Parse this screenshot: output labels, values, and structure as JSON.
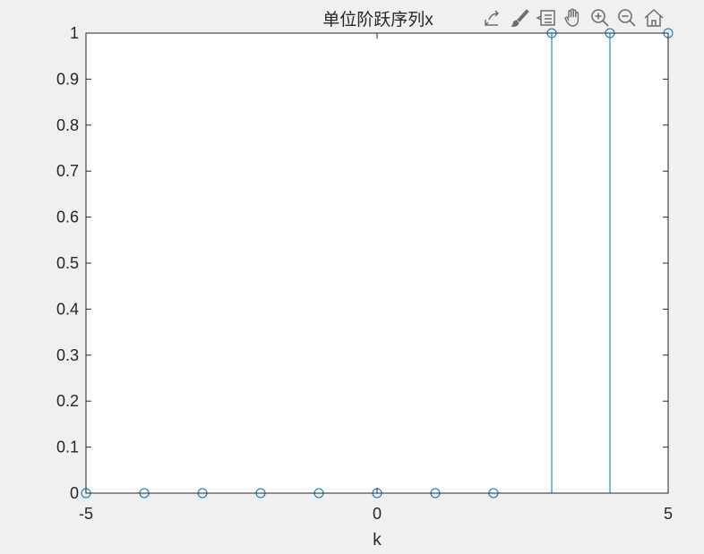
{
  "chart_data": {
    "type": "stem",
    "title": "单位阶跃序列x",
    "xlabel": "k",
    "ylabel": "",
    "xlim": [
      -5,
      5
    ],
    "ylim": [
      0,
      1
    ],
    "x": [
      -5,
      -4,
      -3,
      -2,
      -1,
      0,
      1,
      2,
      3,
      4,
      5
    ],
    "y": [
      0,
      0,
      0,
      0,
      0,
      0,
      0,
      0,
      1,
      1,
      1
    ],
    "xticks": [
      -5,
      0,
      5
    ],
    "xtick_labels": [
      "-5",
      "0",
      "5"
    ],
    "yticks": [
      0,
      0.1,
      0.2,
      0.3,
      0.4,
      0.5,
      0.6,
      0.7,
      0.8,
      0.9,
      1
    ],
    "ytick_labels": [
      "0",
      "0.1",
      "0.2",
      "0.3",
      "0.4",
      "0.5",
      "0.6",
      "0.7",
      "0.8",
      "0.9",
      "1"
    ],
    "grid": false,
    "marker": "circle-open",
    "series_color": "#0072BD",
    "axes_color": "#262626",
    "background_color": "#f0f0f0",
    "plot_background": "#ffffff"
  },
  "toolbar": {
    "icons": [
      "export-icon",
      "brush-icon",
      "datatip-icon",
      "pan-icon",
      "zoom-in-icon",
      "zoom-out-icon",
      "home-icon"
    ]
  }
}
